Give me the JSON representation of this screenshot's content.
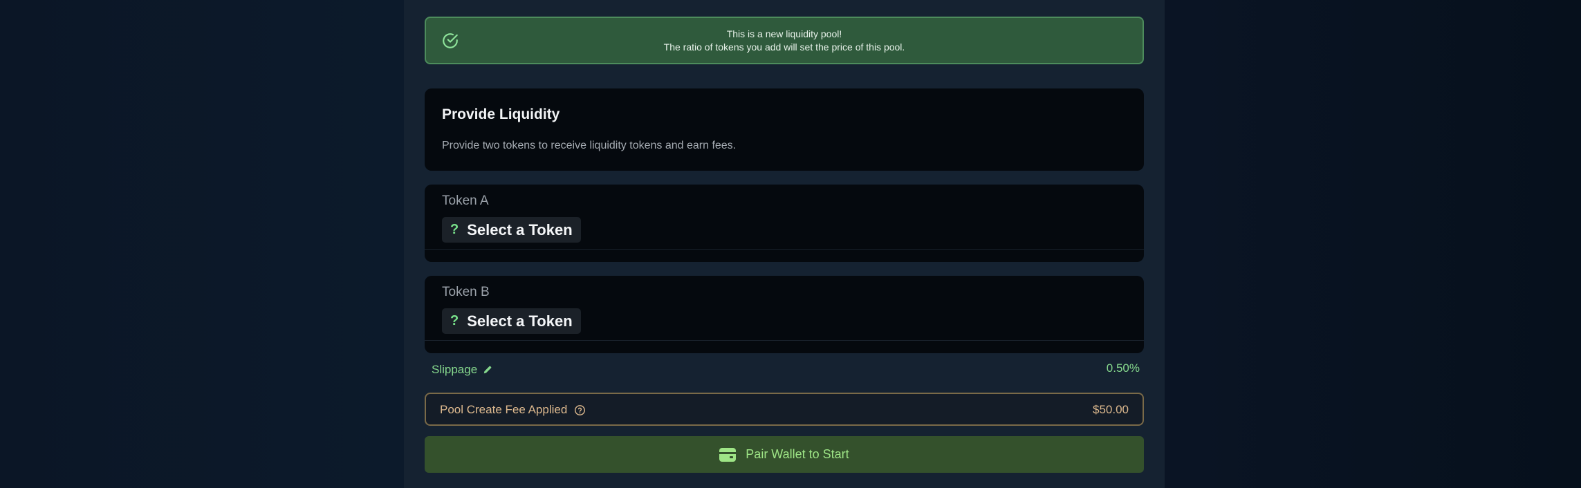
{
  "banner": {
    "line1": "This is a new liquidity pool!",
    "line2": "The ratio of tokens you add will set the price of this pool.",
    "icon": "check-circle-icon",
    "color": "#2f5a3c"
  },
  "provide": {
    "title": "Provide Liquidity",
    "description": "Provide two tokens to receive liquidity tokens and earn fees."
  },
  "token_a": {
    "label": "Token A",
    "button_icon": "?",
    "button_label": "Select a Token"
  },
  "token_b": {
    "label": "Token B",
    "button_icon": "?",
    "button_label": "Select a Token"
  },
  "slippage": {
    "label": "Slippage",
    "value": "0.50%",
    "icon": "pencil-icon"
  },
  "fee": {
    "label": "Pool Create Fee Applied",
    "value": "$50.00",
    "icon": "help-circle-icon",
    "color": "#ddb98e"
  },
  "cta": {
    "label": "Pair Wallet to Start",
    "icon": "wallet-icon",
    "color": "#34512c"
  }
}
